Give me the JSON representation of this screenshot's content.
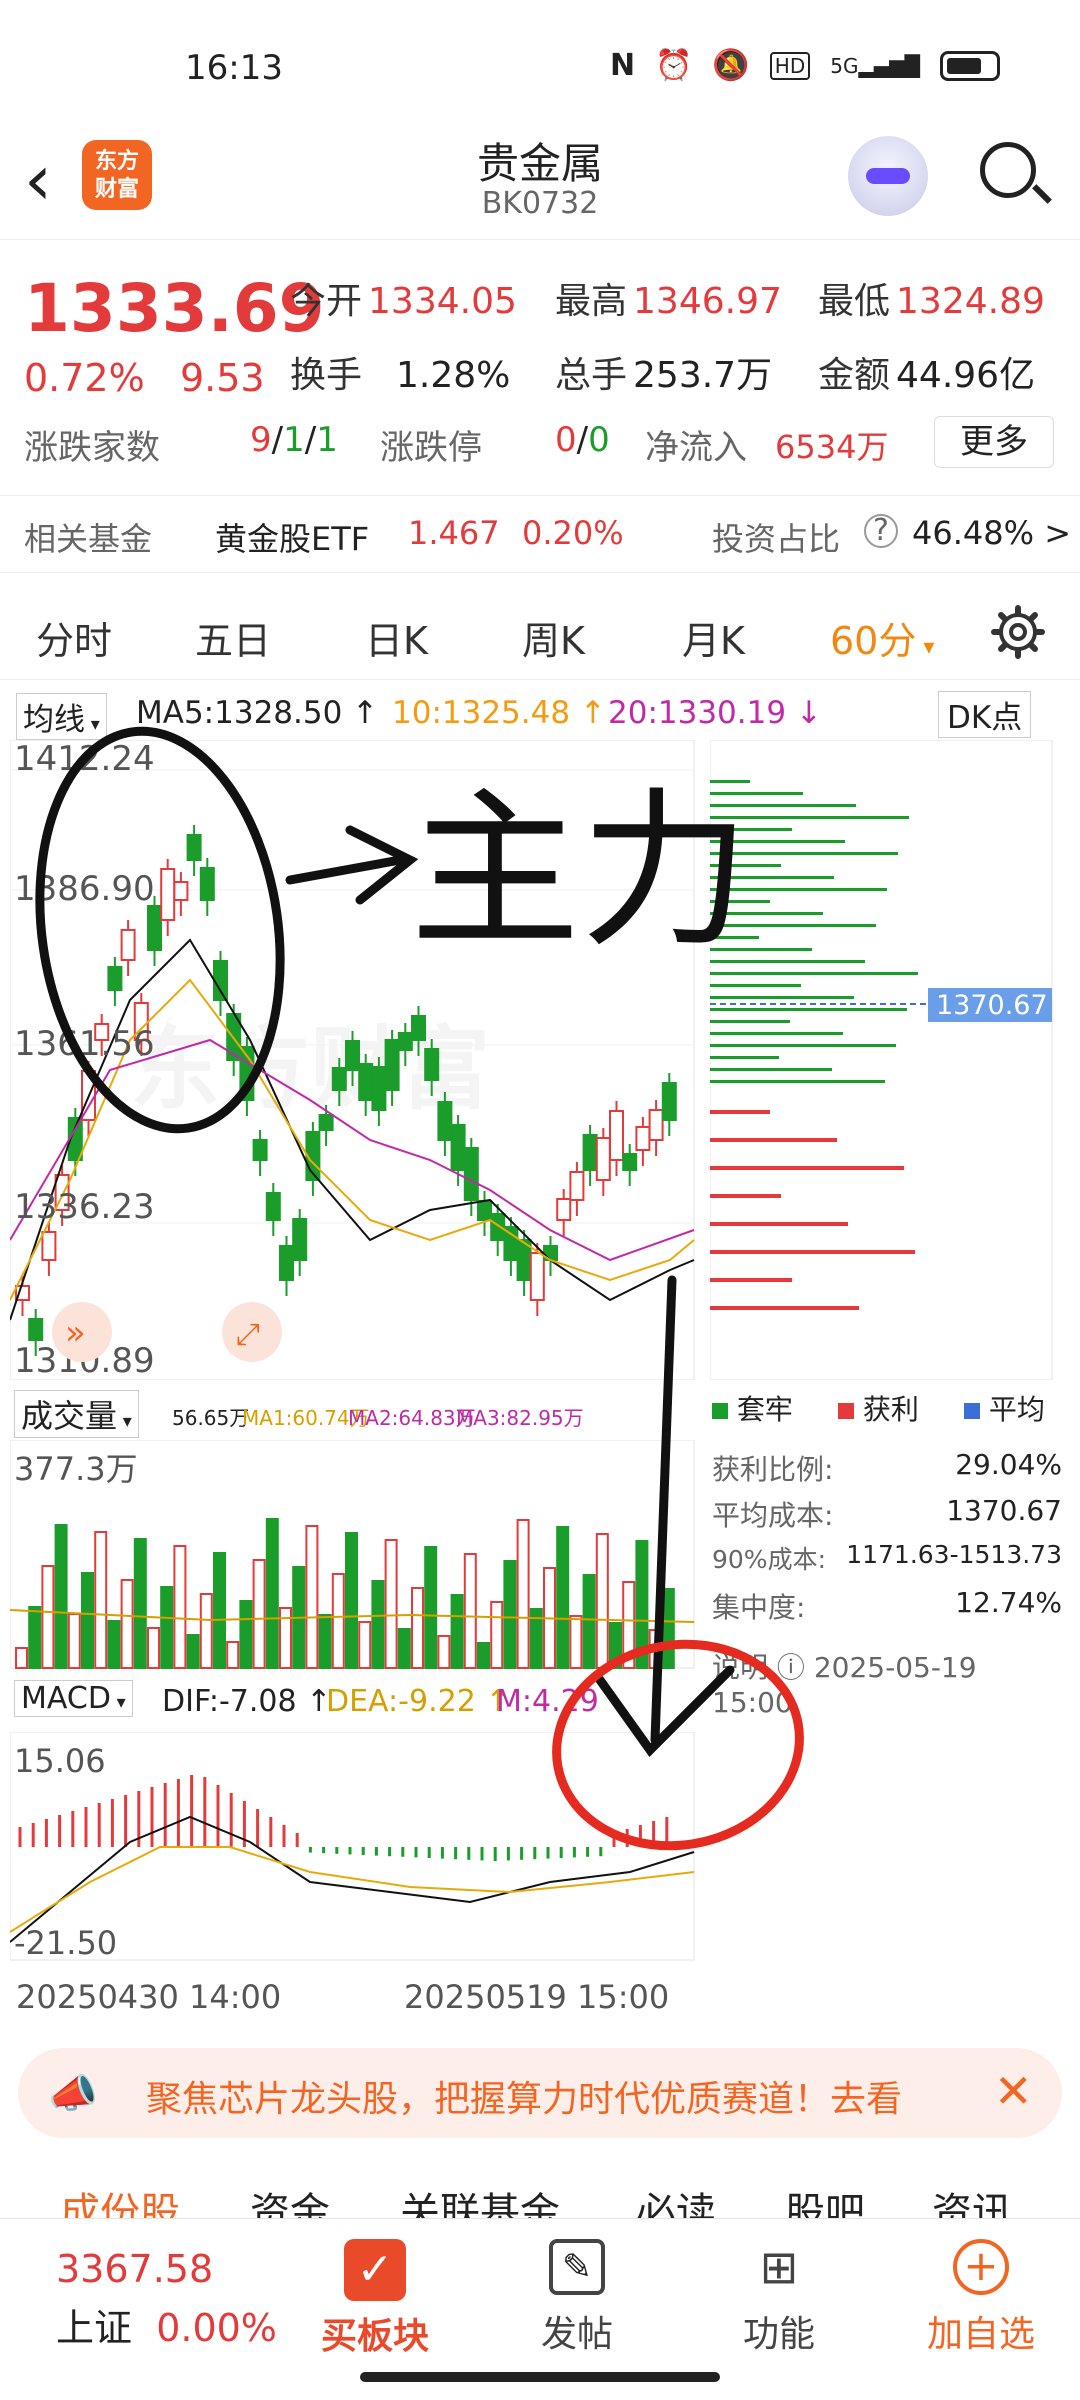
{
  "status": {
    "time": "16:13",
    "net": "5G",
    "hd": "HD"
  },
  "header": {
    "title": "贵金属",
    "code": "BK0732",
    "logo_line1": "东方",
    "logo_line2": "财富"
  },
  "quote": {
    "price": "1333.69",
    "change_pct": "0.72%",
    "change_val": "9.53",
    "open_label": "今开",
    "open": "1334.05",
    "high_label": "最高",
    "high": "1346.97",
    "low_label": "最低",
    "low": "1324.89",
    "turnover_label": "换手",
    "turnover": "1.28%",
    "volume_label": "总手",
    "volume": "253.7万",
    "amount_label": "金额",
    "amount": "44.96亿",
    "updown_label": "涨跌家数",
    "up": "9",
    "down": "1",
    "flat": "1",
    "limit_label": "涨跌停",
    "limit_up": "0",
    "limit_down": "0",
    "netflow_label": "净流入",
    "netflow": "6534万",
    "more_button": "更多"
  },
  "fund": {
    "label": "相关基金",
    "name": "黄金股ETF",
    "price": "1.467",
    "pct": "0.20%",
    "ratio_label": "投资占比",
    "ratio": "46.48% >"
  },
  "tabs": [
    "分时",
    "五日",
    "日K",
    "周K",
    "月K",
    "60分"
  ],
  "active_tab": "60分",
  "ma": {
    "selector": "均线",
    "ma5": "MA5:1328.50",
    "ma10": "10:1325.48",
    "ma20": "20:1330.19",
    "dk": "DK点"
  },
  "price_axis": [
    "1412.24",
    "1386.90",
    "1361.56",
    "1336.23",
    "1310.89"
  ],
  "chip": {
    "marker": "1370.67",
    "legend": [
      "套牢",
      "获利",
      "平均"
    ],
    "profit_ratio_label": "获利比例:",
    "profit_ratio": "29.04%",
    "avg_cost_label": "平均成本:",
    "avg_cost": "1370.67",
    "cost90_label": "90%成本:",
    "cost90": "1171.63-1513.73",
    "concentration_label": "集中度:",
    "concentration": "12.74%",
    "note_label": "说明",
    "note_time": "2025-05-19 15:00"
  },
  "volume": {
    "selector": "成交量",
    "vol": "56.65万",
    "ma1": "MA1:60.74万",
    "ma2": "MA2:64.83万",
    "ma3": "MA3:82.95万",
    "axis_top": "377.3万"
  },
  "macd": {
    "selector": "MACD",
    "dif": "DIF:-7.08",
    "dea": "DEA:-9.22",
    "m": "M:4.29",
    "axis_top": "15.06",
    "axis_bottom": "-21.50"
  },
  "time_axis": {
    "start": "20250430 14:00",
    "end": "20250519 15:00"
  },
  "annotation": {
    "text": "主力"
  },
  "promo": {
    "text": "聚焦芯片龙头股，把握算力时代优质赛道！去看"
  },
  "bottom_tabs": [
    "成份股",
    "资金",
    "关联基金",
    "必读",
    "股吧",
    "资讯"
  ],
  "nav": {
    "index_value": "3367.58",
    "index_name": "上证",
    "index_pct": "0.00%",
    "buy": "买板块",
    "post": "发帖",
    "func": "功能",
    "add": "加自选"
  },
  "colors": {
    "up": "#e33b3b",
    "down": "#1a9d2a",
    "accent": "#f0890f"
  }
}
